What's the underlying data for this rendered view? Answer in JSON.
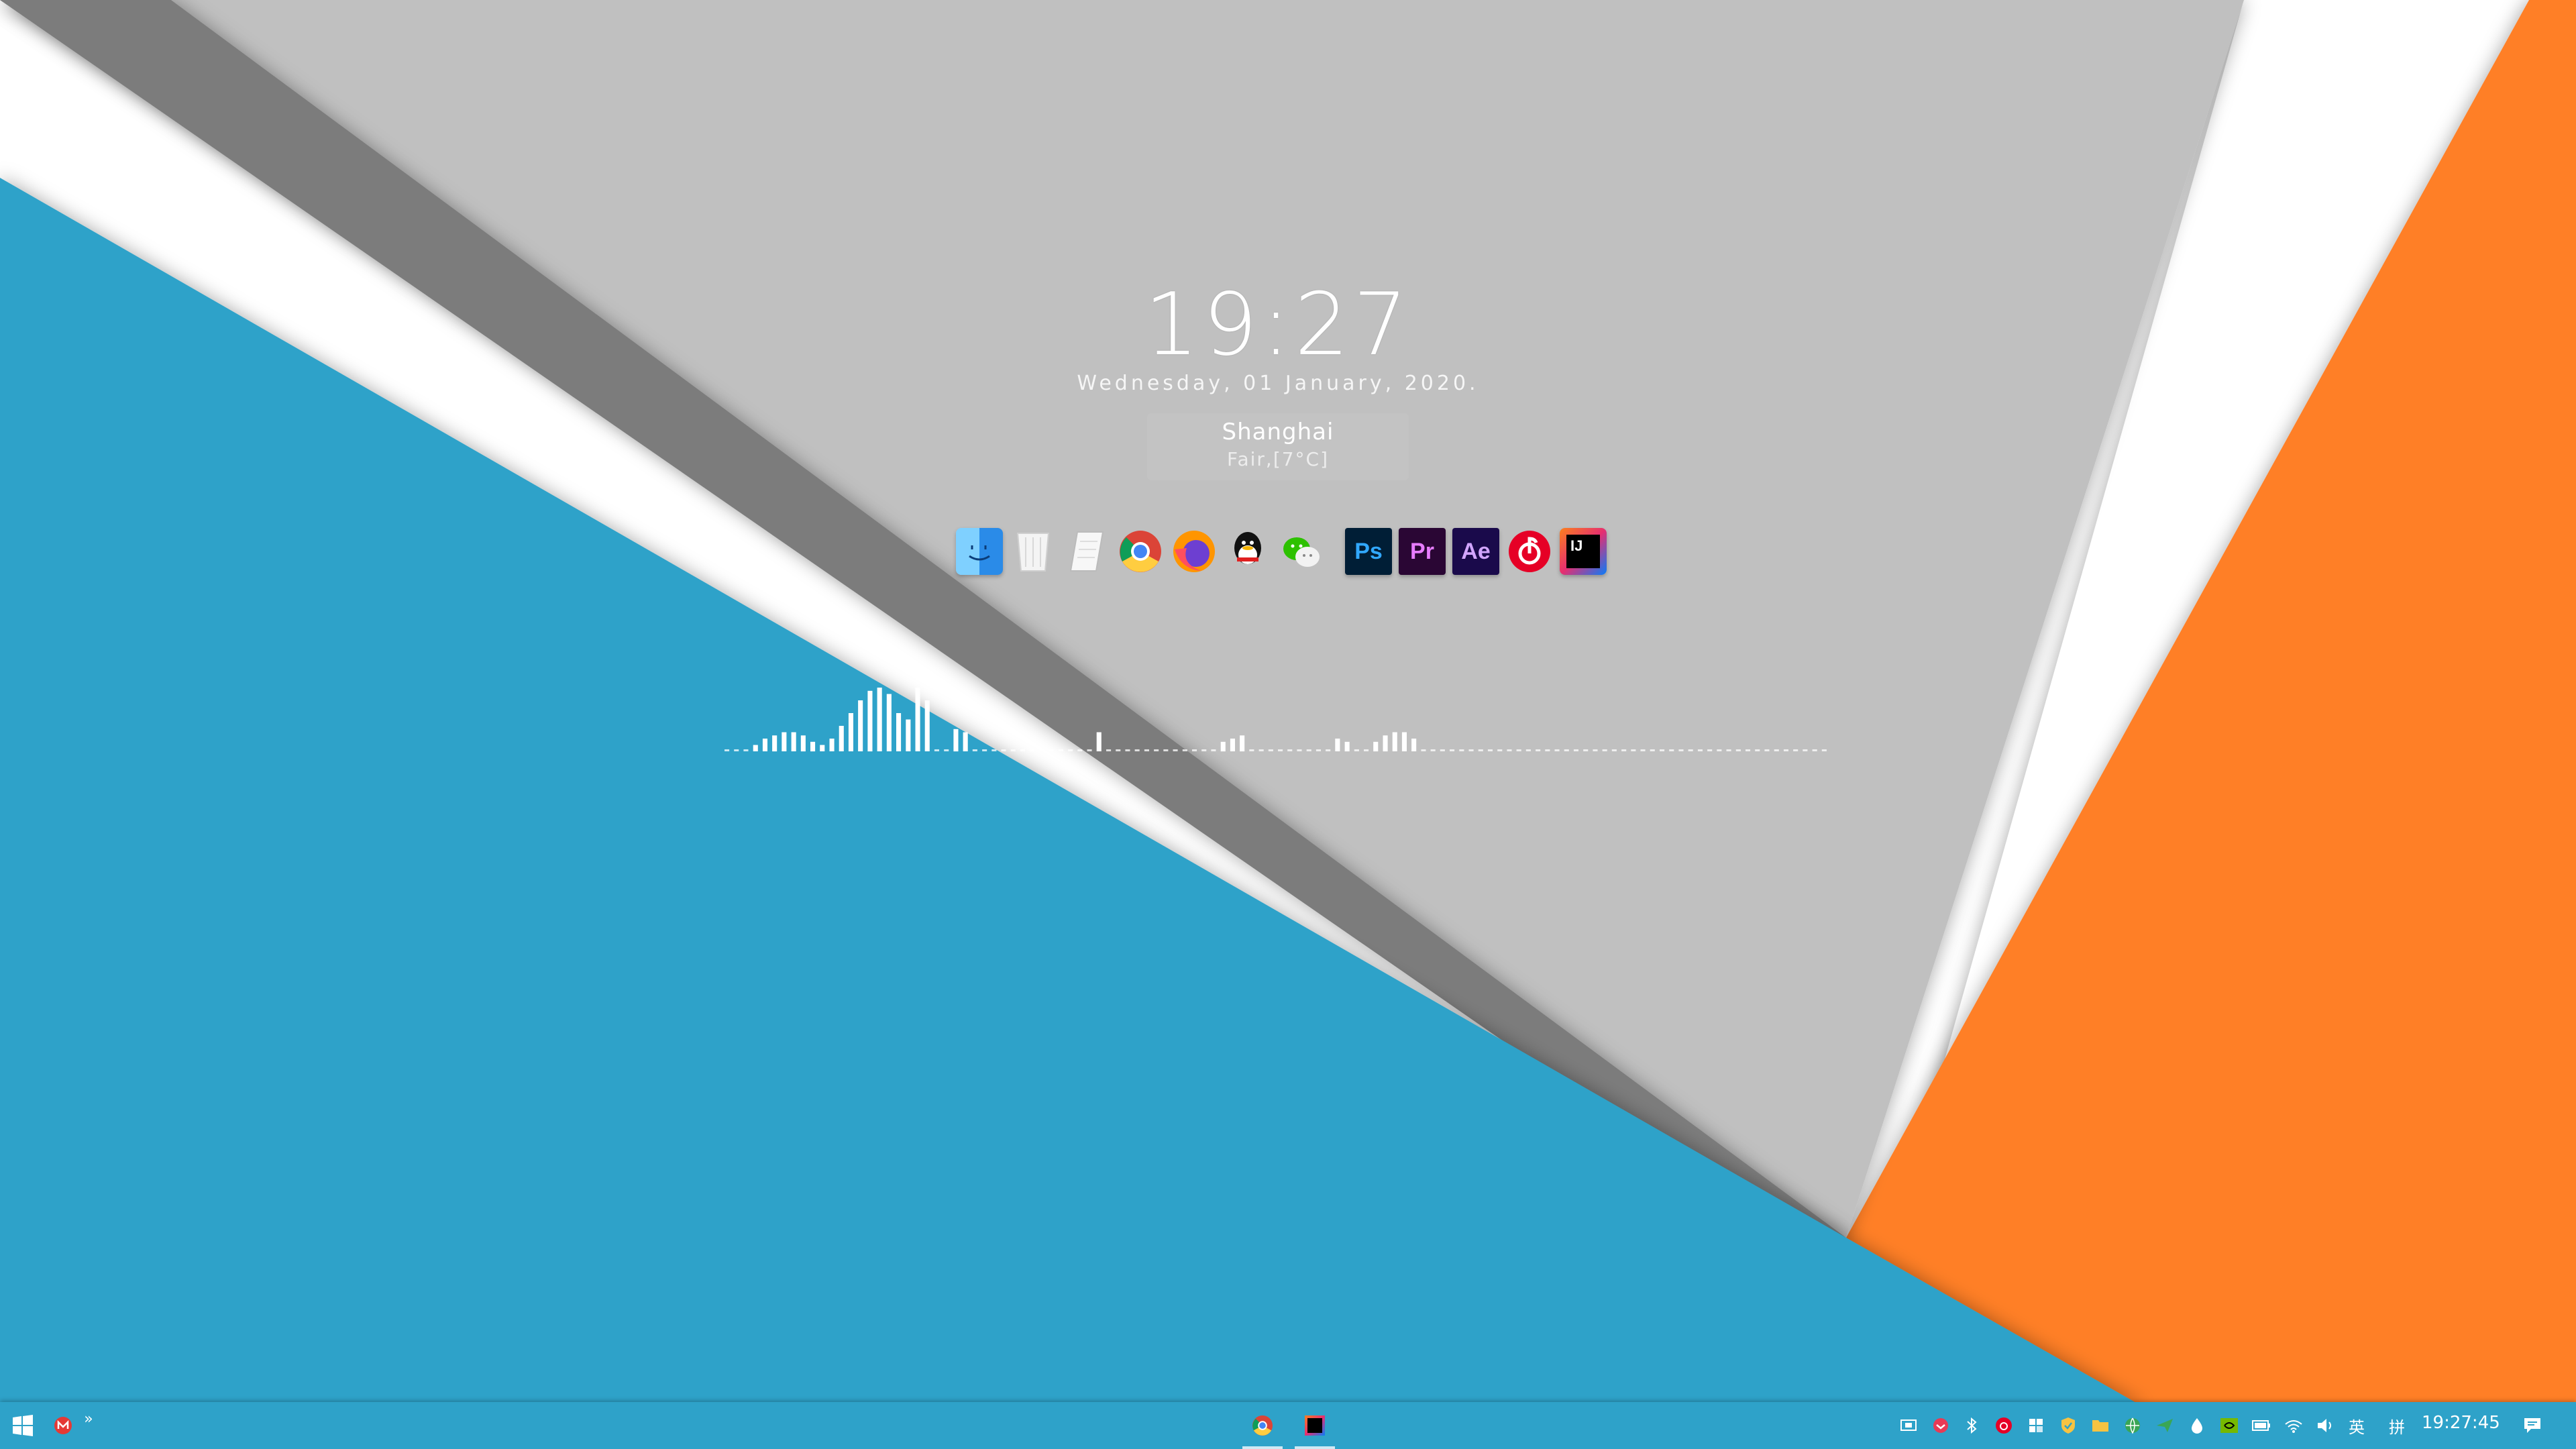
{
  "desktop": {
    "clock": {
      "time": "19:27",
      "date": "Wednesday, 01 January, 2020."
    },
    "weather": {
      "city": "Shanghai",
      "condition": "Fair,[7°C]"
    }
  },
  "dock": {
    "items": [
      {
        "name": "Finder",
        "icon": "finder-icon"
      },
      {
        "name": "Trash",
        "icon": "trash-icon"
      },
      {
        "name": "Notes",
        "icon": "notes-icon"
      },
      {
        "name": "Google Chrome",
        "icon": "chrome-icon"
      },
      {
        "name": "Firefox",
        "icon": "firefox-icon"
      },
      {
        "name": "QQ",
        "icon": "qq-icon"
      },
      {
        "name": "WeChat",
        "icon": "wechat-icon"
      },
      {
        "name": "Photoshop",
        "icon": "photoshop-icon",
        "label": "Ps"
      },
      {
        "name": "Premiere Pro",
        "icon": "premiere-icon",
        "label": "Pr"
      },
      {
        "name": "After Effects",
        "icon": "aftereffects-icon",
        "label": "Ae"
      },
      {
        "name": "NetEase Cloud Music",
        "icon": "netease-music-icon"
      },
      {
        "name": "IntelliJ IDEA",
        "icon": "intellij-icon",
        "label": "IJ"
      }
    ]
  },
  "audio_visualizer": {
    "levels": [
      0,
      0,
      0,
      0.1,
      0.2,
      0.25,
      0.3,
      0.3,
      0.25,
      0.15,
      0.1,
      0.2,
      0.4,
      0.6,
      0.8,
      0.95,
      1,
      0.9,
      0.6,
      0.5,
      1,
      0.8,
      0,
      0,
      0.35,
      0.3,
      0,
      0,
      0,
      0,
      0,
      0,
      0,
      0,
      0,
      0,
      0,
      0,
      0,
      0.3,
      0,
      0,
      0,
      0,
      0,
      0,
      0,
      0,
      0,
      0,
      0,
      0,
      0.15,
      0.2,
      0.25,
      0,
      0,
      0,
      0,
      0,
      0,
      0,
      0,
      0,
      0.2,
      0.15,
      0,
      0,
      0.15,
      0.25,
      0.3,
      0.3,
      0.2,
      0,
      0,
      0,
      0,
      0,
      0,
      0,
      0,
      0,
      0,
      0,
      0,
      0,
      0,
      0,
      0,
      0,
      0,
      0,
      0,
      0,
      0,
      0,
      0,
      0,
      0,
      0,
      0,
      0,
      0,
      0,
      0,
      0,
      0,
      0,
      0,
      0,
      0,
      0,
      0,
      0,
      0,
      0
    ]
  },
  "taskbar": {
    "start": {
      "icon": "windows-start-icon"
    },
    "quick_launch": [
      {
        "icon": "mail-icon"
      }
    ],
    "overflow_label": "»",
    "apps": [
      {
        "icon": "chrome-icon",
        "active": true
      },
      {
        "icon": "intellij-icon",
        "active": true
      }
    ],
    "tray": {
      "icons": [
        "display-icon",
        "pocket-icon",
        "bluetooth-icon",
        "netease-tray-icon",
        "grid-icon",
        "security-icon",
        "folder-icon",
        "network-globe-icon",
        "paper-plane-icon",
        "drop-icon",
        "nvidia-icon",
        "battery-icon",
        "wifi-icon",
        "volume-icon"
      ],
      "ime_label": "英",
      "ime2_label": "拼",
      "time": "19:27:45",
      "notification_icon": "notification-icon"
    }
  },
  "colors": {
    "blue": "#2ea2c9",
    "orange": "#ff7f25",
    "light_gray": "#c0c0c0",
    "dark_gray": "#7b7b7b",
    "white": "#ffffff"
  }
}
